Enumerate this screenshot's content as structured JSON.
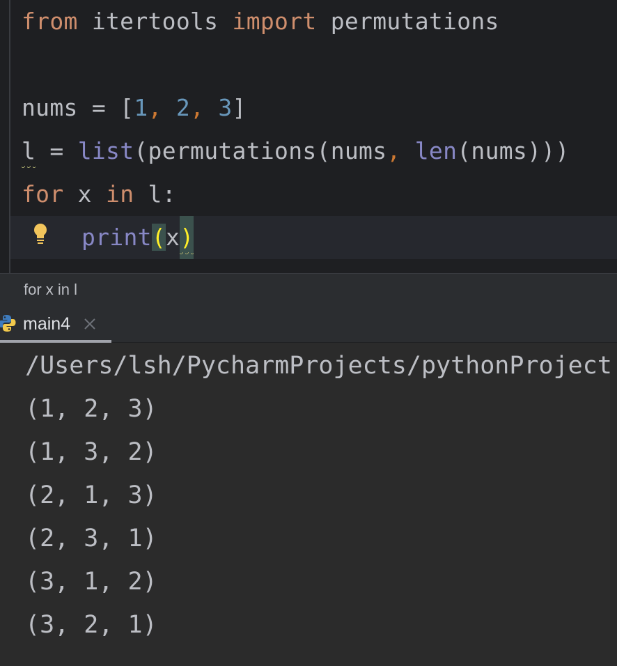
{
  "editor": {
    "lines": [
      {
        "kw1": "from",
        "mod": " itertools ",
        "kw2": "import",
        "name": " permutations"
      },
      {},
      {
        "var": "nums = [",
        "n1": "1",
        "c1": ", ",
        "n2": "2",
        "c2": ", ",
        "n3": "3",
        "end": "]"
      },
      {
        "var": "l",
        "eq": " = ",
        "fn1": "list",
        "p1": "(permutations(nums",
        "comma": ",",
        "sp": " ",
        "fn2": "len",
        "p2": "(nums)))"
      },
      {
        "kw1": "for",
        "x": " x ",
        "kw2": "in",
        "rest": " l:"
      },
      {
        "fn": "print",
        "open": "(",
        "arg": "x",
        "close": ")"
      }
    ]
  },
  "breadcrumb": {
    "text": "for x in l"
  },
  "run_tab": {
    "label": "main4"
  },
  "console": {
    "path": "/Users/lsh/PycharmProjects/pythonProject",
    "output": [
      "(1, 2, 3)",
      "(1, 3, 2)",
      "(2, 1, 3)",
      "(2, 3, 1)",
      "(3, 1, 2)",
      "(3, 2, 1)"
    ]
  },
  "colors": {
    "editor_bg": "#1e1f22",
    "keyword": "#cf8e6d",
    "number": "#6897bb",
    "builtin": "#8888c6",
    "text": "#bcbec4"
  },
  "icons": {
    "bulb": "lightbulb-icon",
    "tab": "python-icon",
    "close": "close-icon"
  }
}
